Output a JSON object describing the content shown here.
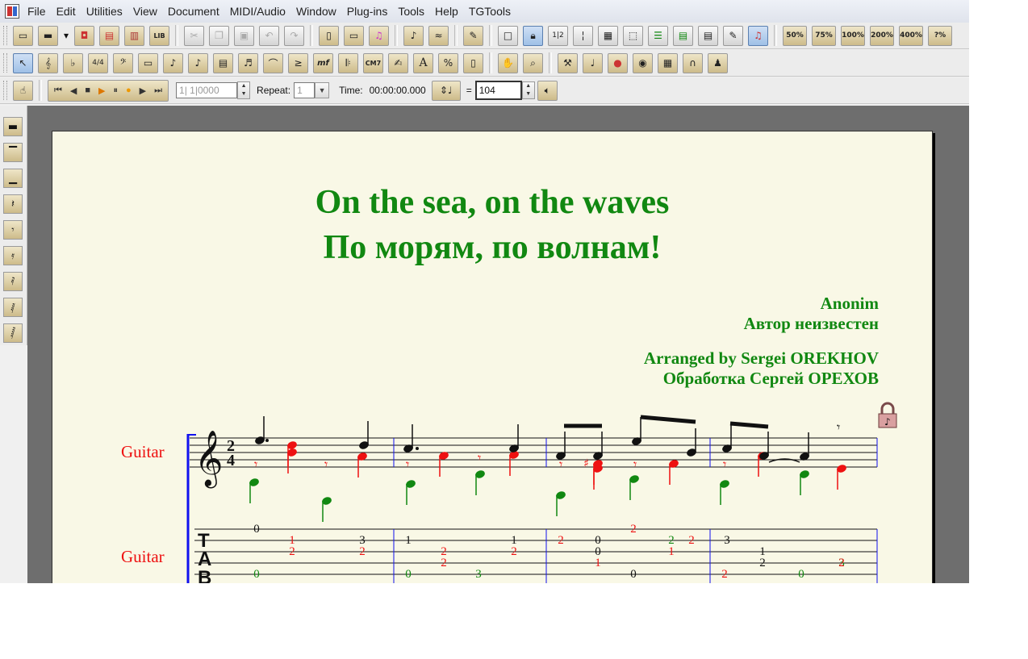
{
  "menu": [
    "File",
    "Edit",
    "Utilities",
    "View",
    "Document",
    "MIDI/Audio",
    "Window",
    "Plug-ins",
    "Tools",
    "Help",
    "TGTools"
  ],
  "toolbar": {
    "zoom_buttons": [
      "50%",
      "75%",
      "100%",
      "200%",
      "400%",
      "?%"
    ],
    "measure_field": "1| 1|0000",
    "repeat_label": "Repeat:",
    "repeat_value": "1",
    "time_label": "Time:",
    "time_value": "00:00:00.000",
    "equals": "=",
    "tempo_value": "104"
  },
  "score": {
    "title_en": "On the sea, on the waves",
    "title_ru": "По морям, по волнам!",
    "composer_en": "Anonim",
    "composer_ru": "Автор неизвестен",
    "arranger_en": "Arranged by Sergei OREKHOV",
    "arranger_ru": "Обработка Сергей ОРЕХОВ",
    "staff_label": "Guitar",
    "tab_label": "Guitar",
    "time_sig_top": "2",
    "time_sig_bottom": "4",
    "tab_letters": [
      "T",
      "A",
      "B"
    ],
    "tab_numbers": [
      {
        "text": "0",
        "color": "#111111"
      },
      {
        "text": "1",
        "color": "#ee1111"
      },
      {
        "text": "2",
        "color": "#ee1111"
      },
      {
        "text": "3",
        "color": "#111111"
      },
      {
        "text": "2",
        "color": "#ee1111"
      },
      {
        "text": "0",
        "color": "#118811"
      },
      {
        "text": "1",
        "color": "#111111"
      },
      {
        "text": "2",
        "color": "#ee1111"
      },
      {
        "text": "2",
        "color": "#ee1111"
      },
      {
        "text": "0",
        "color": "#118811"
      },
      {
        "text": "3",
        "color": "#118811"
      },
      {
        "text": "1",
        "color": "#111111"
      },
      {
        "text": "2",
        "color": "#ee1111"
      },
      {
        "text": "2",
        "color": "#ee1111"
      },
      {
        "text": "0",
        "color": "#111111"
      },
      {
        "text": "0",
        "color": "#111111"
      },
      {
        "text": "1",
        "color": "#ee1111"
      },
      {
        "text": "2",
        "color": "#ee1111"
      },
      {
        "text": "0",
        "color": "#111111"
      },
      {
        "text": "2",
        "color": "#118811"
      },
      {
        "text": "1",
        "color": "#ee1111"
      },
      {
        "text": "2",
        "color": "#ee1111"
      },
      {
        "text": "3",
        "color": "#111111"
      },
      {
        "text": "1",
        "color": "#111111"
      },
      {
        "text": "2",
        "color": "#111111"
      },
      {
        "text": "2",
        "color": "#ee1111"
      },
      {
        "text": "0",
        "color": "#118811"
      },
      {
        "text": "3",
        "color": "#118811"
      },
      {
        "text": "2",
        "color": "#ee1111"
      }
    ]
  },
  "colors": {
    "voice_top": "#111111",
    "voice_mid": "#ee1111",
    "voice_bass": "#118811",
    "title": "#118811"
  }
}
